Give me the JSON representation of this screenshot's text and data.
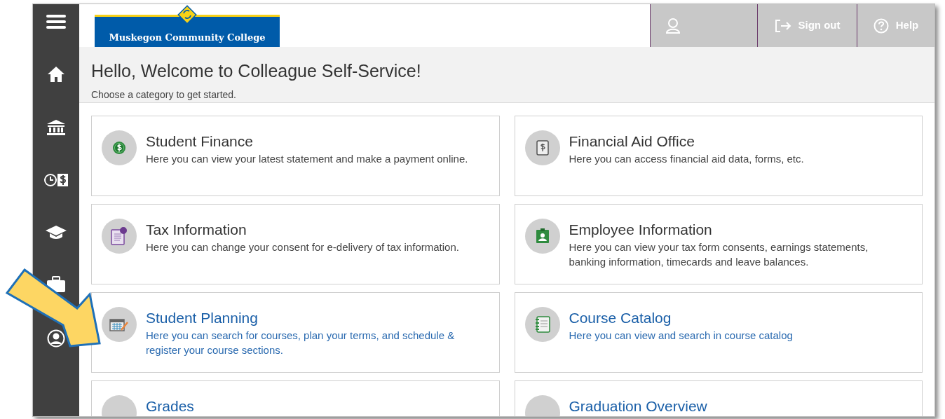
{
  "header": {
    "logo_text": "Muskegon Community College",
    "actions": [
      {
        "kind": "user"
      },
      {
        "kind": "signout",
        "label": "Sign out"
      },
      {
        "kind": "help",
        "label": "Help"
      }
    ]
  },
  "sidebar": {
    "items": [
      {
        "kind": "menu"
      },
      {
        "kind": "home"
      },
      {
        "kind": "bank"
      },
      {
        "kind": "clock-dollar"
      },
      {
        "kind": "cap"
      },
      {
        "kind": "briefcase"
      },
      {
        "kind": "person"
      }
    ]
  },
  "welcome": {
    "title": "Hello, Welcome to Colleague Self-Service!",
    "subtitle": "Choose a category to get started."
  },
  "categories": [
    {
      "kind": "plain",
      "title": "Student Finance",
      "description": "Here you can view your latest statement and make a payment online."
    },
    {
      "kind": "plain",
      "title": "Financial Aid Office",
      "description": "Here you can access financial aid data, forms, etc."
    },
    {
      "kind": "plain",
      "title": "Tax Information",
      "description": "Here you can change your consent for e-delivery of tax information."
    },
    {
      "kind": "plain",
      "title": "Employee Information",
      "description": "Here you can view your tax form consents, earnings statements, banking information, timecards and leave balances."
    },
    {
      "kind": "link",
      "title": "Student Planning",
      "description": "Here you can search for courses, plan your terms, and schedule & register your course sections."
    },
    {
      "kind": "link",
      "title": "Course Catalog",
      "description": "Here you can view and search in course catalog"
    },
    {
      "kind": "link",
      "title": "Grades"
    },
    {
      "kind": "link",
      "title": "Graduation Overview"
    }
  ]
}
